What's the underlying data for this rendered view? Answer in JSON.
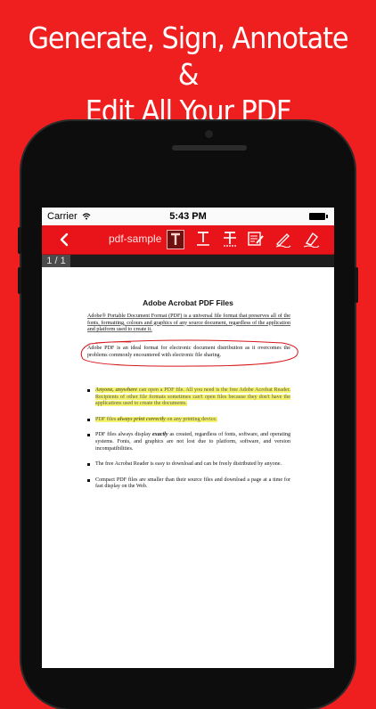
{
  "promo": {
    "line1": "Generate, Sign, Annotate &",
    "line2": "Edit All Your PDF Documents"
  },
  "status_bar": {
    "carrier": "Carrier",
    "time": "5:43 PM"
  },
  "toolbar": {
    "back_icon": "chevron-left-icon",
    "title": "pdf-sample",
    "tools": [
      {
        "name": "text-tool-icon",
        "active": true
      },
      {
        "name": "underline-text-icon",
        "active": false
      },
      {
        "name": "strikethrough-text-icon",
        "active": false
      },
      {
        "name": "note-edit-icon",
        "active": false
      },
      {
        "name": "pen-icon",
        "active": false
      },
      {
        "name": "eraser-icon",
        "active": false
      }
    ]
  },
  "page_indicator": "1 / 1",
  "document": {
    "heading": "Adobe Acrobat PDF Files",
    "para1": "Adobe® Portable Document Format (PDF) is a universal file format that preserves all of the fonts, formatting, colours and graphics of any source document, regardless of the application and platform used to create it.",
    "para2": "Adobe PDF is an ideal format for electronic document distribution as it overcomes the problems commonly encountered with electronic file sharing.",
    "bullets": [
      {
        "em": "Anyone, anywhere",
        "text": " can open a PDF file. All you need is the free Adobe Acrobat Reader. Recipients of other file formats sometimes can't open files because they don't have the applications used to create the documents.",
        "highlight": true
      },
      {
        "pre": "PDF files ",
        "em": "always print correctly",
        "text": " on any printing device.",
        "highlight": true
      },
      {
        "pre": "PDF files always display ",
        "em": "exactly",
        "text": " as created, regardless of fonts, software, and operating systems. Fonts, and graphics are not lost due to platform, software, and version incompatibilities.",
        "highlight": false
      },
      {
        "pre": "",
        "em": "",
        "text": "The free Acrobat Reader is easy to download and can be freely distributed by anyone.",
        "highlight": false
      },
      {
        "pre": "",
        "em": "",
        "text": "Compact PDF files are smaller than their source files and download a page at a time for fast display on the Web.",
        "highlight": false
      }
    ]
  },
  "colors": {
    "background": "#f01f1f",
    "toolbar": "#e8141a",
    "highlight": "#f4f36a",
    "annotation": "#d6161c"
  }
}
